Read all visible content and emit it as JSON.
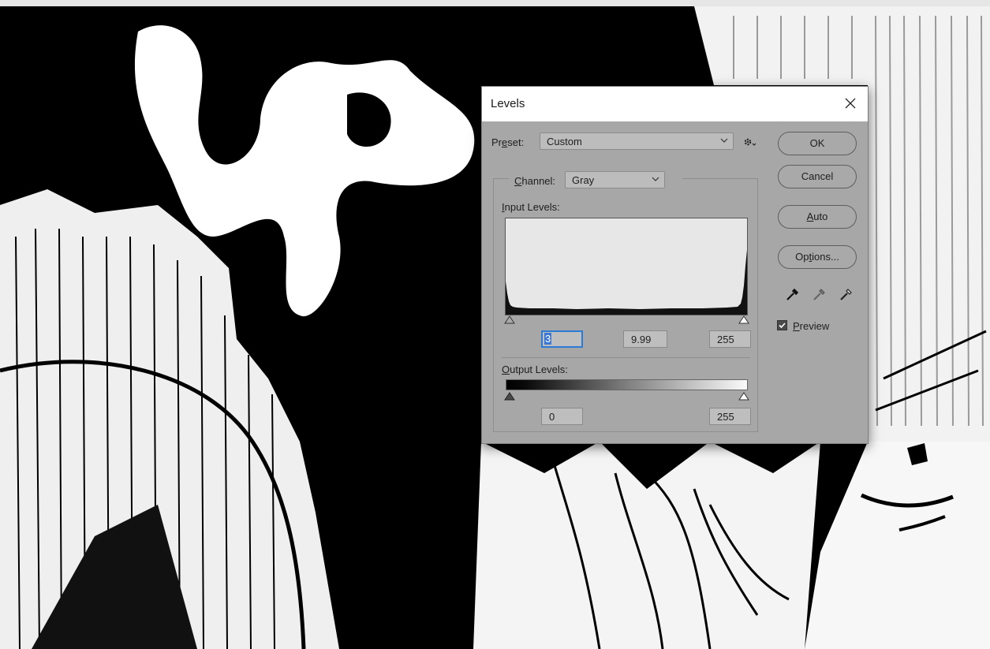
{
  "dialog": {
    "title": "Levels",
    "preset": {
      "label_pre": "Pr",
      "label_key": "e",
      "label_post": "set:",
      "value": "Custom"
    },
    "channel": {
      "label_key": "C",
      "label_post": "hannel:",
      "value": "Gray"
    },
    "input_levels": {
      "label_key": "I",
      "label_post": "nput Levels:",
      "black": "3",
      "gamma": "9.99",
      "white": "255"
    },
    "output_levels": {
      "label_key": "O",
      "label_post": "utput Levels:",
      "black": "0",
      "white": "255"
    },
    "buttons": {
      "ok": "OK",
      "cancel": "Cancel",
      "auto_key": "A",
      "auto_post": "uto",
      "options_pre": "Op",
      "options_key": "t",
      "options_post": "ions..."
    },
    "preview": {
      "label_key": "P",
      "label_post": "review",
      "checked": true
    }
  },
  "icons": [
    "close-icon",
    "gear-icon",
    "chevron-down-icon",
    "black-eyedropper-icon",
    "gray-eyedropper-icon",
    "white-eyedropper-icon",
    "checkmark-icon",
    "slider-triangle-icon"
  ],
  "colors": {
    "dialog_bg": "#a7a7a7",
    "titlebar_bg": "#ffffff",
    "focus_blue": "#2b7ad6",
    "histogram_bg": "#e7e7e7"
  }
}
